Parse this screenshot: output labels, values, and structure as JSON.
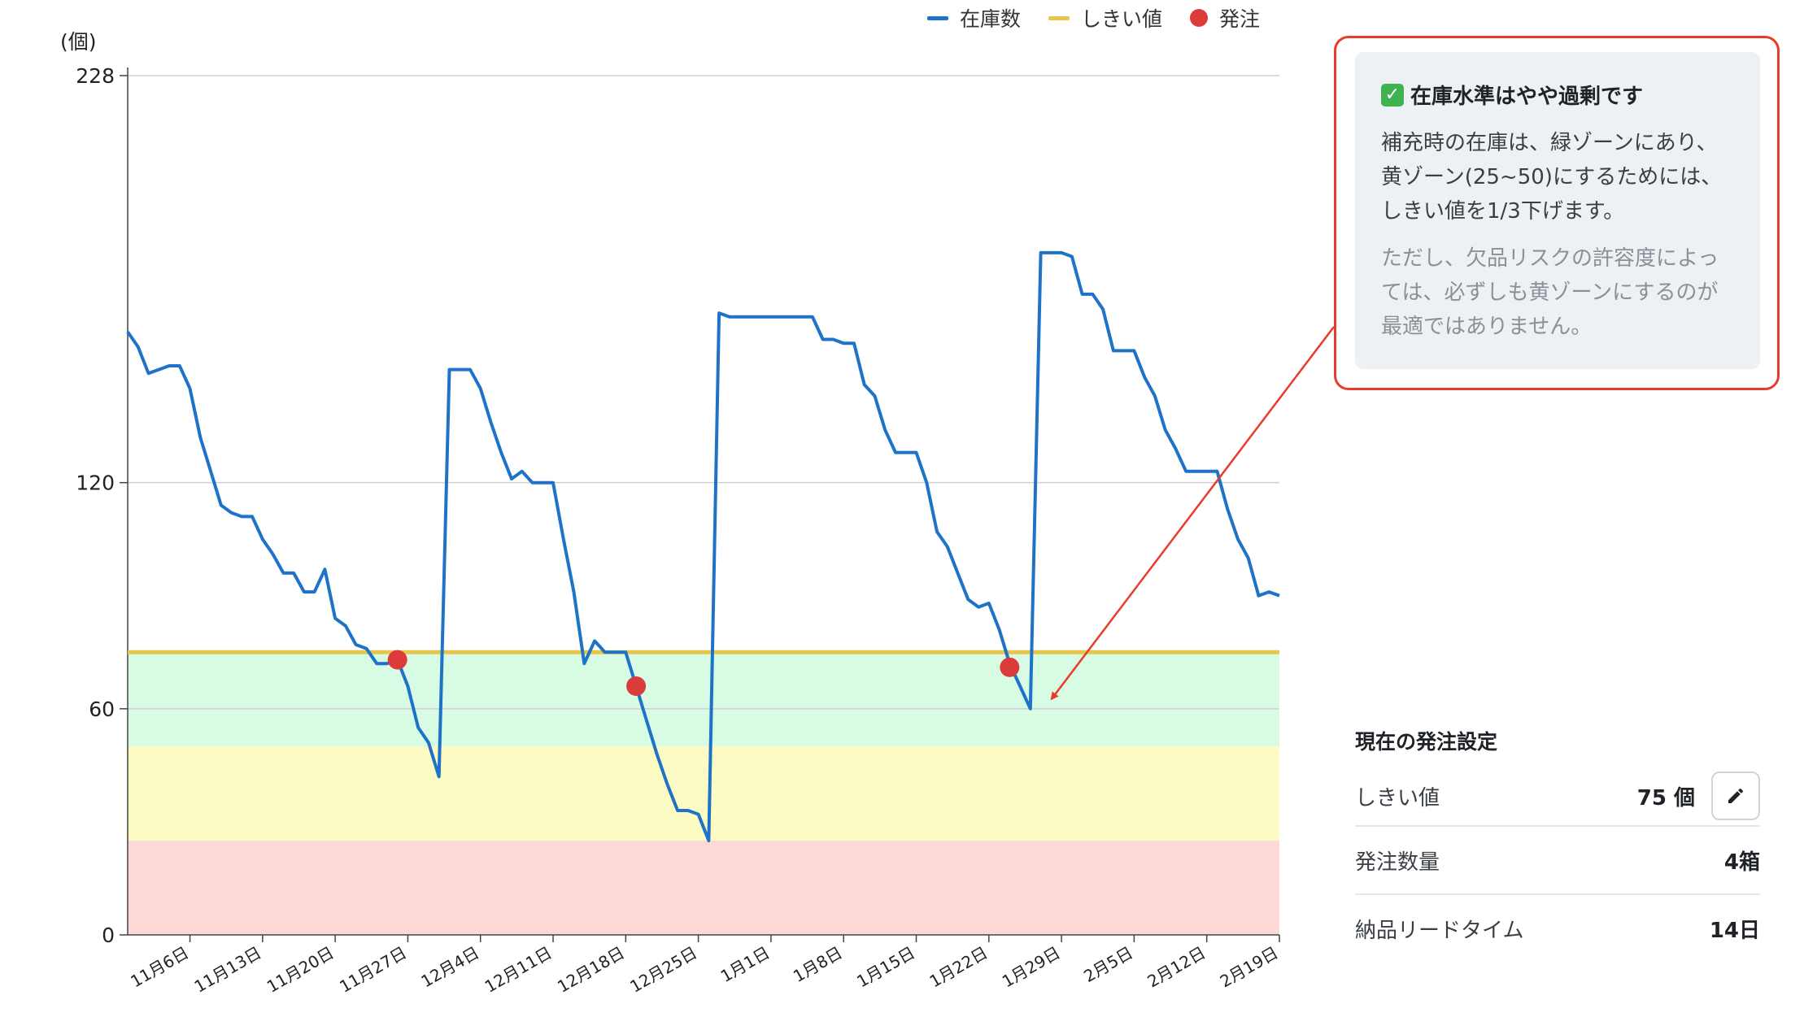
{
  "chart_data": {
    "type": "line",
    "ylabel": "(個)",
    "ylim": [
      0,
      228
    ],
    "yticks": [
      "0",
      "60",
      "120",
      "228"
    ],
    "xlim": [
      "2024-10-31",
      "2025-02-19"
    ],
    "x_tick_labels": [
      {
        "date": "2024-11-06",
        "label": "11月6日"
      },
      {
        "date": "2024-11-13",
        "label": "11月13日"
      },
      {
        "date": "2024-11-20",
        "label": "11月20日"
      },
      {
        "date": "2024-11-27",
        "label": "11月27日"
      },
      {
        "date": "2024-12-04",
        "label": "12月4日"
      },
      {
        "date": "2024-12-11",
        "label": "12月11日"
      },
      {
        "date": "2024-12-18",
        "label": "12月18日"
      },
      {
        "date": "2024-12-25",
        "label": "12月25日"
      },
      {
        "date": "2025-01-01",
        "label": "1月1日"
      },
      {
        "date": "2025-01-08",
        "label": "1月8日"
      },
      {
        "date": "2025-01-15",
        "label": "1月15日"
      },
      {
        "date": "2025-01-22",
        "label": "1月22日"
      },
      {
        "date": "2025-01-29",
        "label": "1月29日"
      },
      {
        "date": "2025-02-05",
        "label": "2月5日"
      },
      {
        "date": "2025-02-12",
        "label": "2月12日"
      },
      {
        "date": "2025-02-19",
        "label": "2月19日"
      }
    ],
    "legend": [
      "在庫数",
      "しきい値",
      "発注"
    ],
    "legend_position": "top",
    "zones": [
      {
        "name": "red",
        "from": 0,
        "to": 25,
        "color": "#fdd8d6"
      },
      {
        "name": "yellow",
        "from": 25,
        "to": 50,
        "color": "#fdfbc4"
      },
      {
        "name": "green",
        "from": 50,
        "to": 75,
        "color": "#d8fbe3"
      }
    ],
    "series": [
      {
        "name": "在庫数",
        "color": "#1e73c8",
        "points": [
          [
            "2024-10-31",
            160
          ],
          [
            "2024-11-01",
            156
          ],
          [
            "2024-11-02",
            149
          ],
          [
            "2024-11-03",
            150
          ],
          [
            "2024-11-04",
            151
          ],
          [
            "2024-11-05",
            151
          ],
          [
            "2024-11-06",
            145
          ],
          [
            "2024-11-07",
            132
          ],
          [
            "2024-11-08",
            123
          ],
          [
            "2024-11-09",
            114
          ],
          [
            "2024-11-10",
            112
          ],
          [
            "2024-11-11",
            111
          ],
          [
            "2024-11-12",
            111
          ],
          [
            "2024-11-13",
            105
          ],
          [
            "2024-11-14",
            101
          ],
          [
            "2024-11-15",
            96
          ],
          [
            "2024-11-16",
            96
          ],
          [
            "2024-11-17",
            91
          ],
          [
            "2024-11-18",
            91
          ],
          [
            "2024-11-19",
            97
          ],
          [
            "2024-11-20",
            84
          ],
          [
            "2024-11-21",
            82
          ],
          [
            "2024-11-22",
            77
          ],
          [
            "2024-11-23",
            76
          ],
          [
            "2024-11-24",
            72
          ],
          [
            "2024-11-25",
            72
          ],
          [
            "2024-11-26",
            73
          ],
          [
            "2024-11-27",
            66
          ],
          [
            "2024-11-28",
            55
          ],
          [
            "2024-11-29",
            51
          ],
          [
            "2024-11-30",
            42
          ],
          [
            "2024-12-01",
            150
          ],
          [
            "2024-12-02",
            150
          ],
          [
            "2024-12-03",
            150
          ],
          [
            "2024-12-04",
            145
          ],
          [
            "2024-12-05",
            136
          ],
          [
            "2024-12-06",
            128
          ],
          [
            "2024-12-07",
            121
          ],
          [
            "2024-12-08",
            123
          ],
          [
            "2024-12-09",
            120
          ],
          [
            "2024-12-10",
            120
          ],
          [
            "2024-12-11",
            120
          ],
          [
            "2024-12-12",
            105
          ],
          [
            "2024-12-13",
            91
          ],
          [
            "2024-12-14",
            72
          ],
          [
            "2024-12-15",
            78
          ],
          [
            "2024-12-16",
            75
          ],
          [
            "2024-12-17",
            75
          ],
          [
            "2024-12-18",
            75
          ],
          [
            "2024-12-19",
            66
          ],
          [
            "2024-12-20",
            57
          ],
          [
            "2024-12-21",
            48
          ],
          [
            "2024-12-22",
            40
          ],
          [
            "2024-12-23",
            33
          ],
          [
            "2024-12-24",
            33
          ],
          [
            "2024-12-25",
            32
          ],
          [
            "2024-12-26",
            25
          ],
          [
            "2024-12-27",
            165
          ],
          [
            "2024-12-28",
            164
          ],
          [
            "2024-12-29",
            164
          ],
          [
            "2024-12-30",
            164
          ],
          [
            "2024-12-31",
            164
          ],
          [
            "2025-01-01",
            164
          ],
          [
            "2025-01-02",
            164
          ],
          [
            "2025-01-03",
            164
          ],
          [
            "2025-01-04",
            164
          ],
          [
            "2025-01-05",
            164
          ],
          [
            "2025-01-06",
            158
          ],
          [
            "2025-01-07",
            158
          ],
          [
            "2025-01-08",
            157
          ],
          [
            "2025-01-09",
            157
          ],
          [
            "2025-01-10",
            146
          ],
          [
            "2025-01-11",
            143
          ],
          [
            "2025-01-12",
            134
          ],
          [
            "2025-01-13",
            128
          ],
          [
            "2025-01-14",
            128
          ],
          [
            "2025-01-15",
            128
          ],
          [
            "2025-01-16",
            120
          ],
          [
            "2025-01-17",
            107
          ],
          [
            "2025-01-18",
            103
          ],
          [
            "2025-01-19",
            96
          ],
          [
            "2025-01-20",
            89
          ],
          [
            "2025-01-21",
            87
          ],
          [
            "2025-01-22",
            88
          ],
          [
            "2025-01-23",
            81
          ],
          [
            "2025-01-24",
            72
          ],
          [
            "2025-01-25",
            66
          ],
          [
            "2025-01-26",
            60
          ],
          [
            "2025-01-27",
            181
          ],
          [
            "2025-01-28",
            181
          ],
          [
            "2025-01-29",
            181
          ],
          [
            "2025-01-30",
            180
          ],
          [
            "2025-01-31",
            170
          ],
          [
            "2025-02-01",
            170
          ],
          [
            "2025-02-02",
            166
          ],
          [
            "2025-02-03",
            155
          ],
          [
            "2025-02-04",
            155
          ],
          [
            "2025-02-05",
            155
          ],
          [
            "2025-02-06",
            148
          ],
          [
            "2025-02-07",
            143
          ],
          [
            "2025-02-08",
            134
          ],
          [
            "2025-02-09",
            129
          ],
          [
            "2025-02-10",
            123
          ],
          [
            "2025-02-11",
            123
          ],
          [
            "2025-02-12",
            123
          ],
          [
            "2025-02-13",
            123
          ],
          [
            "2025-02-14",
            113
          ],
          [
            "2025-02-15",
            105
          ],
          [
            "2025-02-16",
            100
          ],
          [
            "2025-02-17",
            90
          ],
          [
            "2025-02-18",
            91
          ],
          [
            "2025-02-19",
            90
          ]
        ]
      },
      {
        "name": "しきい値",
        "color": "#e7c74a",
        "points": [
          [
            "2024-10-31",
            75
          ],
          [
            "2025-02-19",
            75
          ]
        ]
      },
      {
        "name": "発注",
        "color": "#dc3b3b",
        "points": [
          [
            "2024-11-26",
            73
          ],
          [
            "2024-12-19",
            66
          ],
          [
            "2025-01-24",
            71
          ]
        ]
      }
    ]
  },
  "annotation": {
    "title": "在庫水準はやや過剰です",
    "body": "補充時の在庫は、緑ゾーンにあり、黄ゾーン(25~50)にするためには、しきい値を1/3下げます。",
    "note": "ただし、欠品リスクの許容度によっては、必ずしも黄ゾーンにするのが最適ではありません。",
    "icon": "check-mark-icon",
    "arrow_target": [
      "2025-01-26",
      60
    ],
    "accent_color": "#ea3a2a"
  },
  "settings": {
    "title": "現在の発注設定",
    "rows": [
      {
        "label": "しきい値",
        "value": "75 個",
        "editable": true
      },
      {
        "label": "発注数量",
        "value": "4箱"
      },
      {
        "label": "納品リードタイム",
        "value": "14日"
      }
    ],
    "edit_icon": "pencil-icon"
  }
}
